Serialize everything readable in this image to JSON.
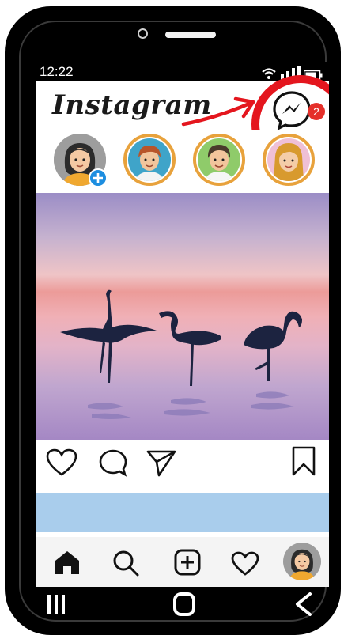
{
  "status_bar": {
    "time": "12:22"
  },
  "header": {
    "logo": "Instagram",
    "messenger_badge_count": "2"
  },
  "stories": [
    {
      "name": "your-story",
      "has_add": true,
      "ring": "none"
    },
    {
      "name": "story-boy",
      "ring": "gradient"
    },
    {
      "name": "story-man",
      "ring": "gradient"
    },
    {
      "name": "story-girl",
      "ring": "gradient"
    }
  ],
  "post_actions": [
    "heart-icon",
    "comment-icon",
    "share-icon",
    "bookmark-icon"
  ],
  "bottom_nav": [
    "home-icon",
    "search-icon",
    "add-post-icon",
    "activity-icon",
    "profile-avatar"
  ],
  "system_nav": [
    "recent-apps-icon",
    "home-circle-icon",
    "back-icon"
  ],
  "colors": {
    "highlight": "#e4161e",
    "badge": "#e5302a",
    "story_ring": "#e8a23c",
    "next_post": "#a9cdec"
  }
}
